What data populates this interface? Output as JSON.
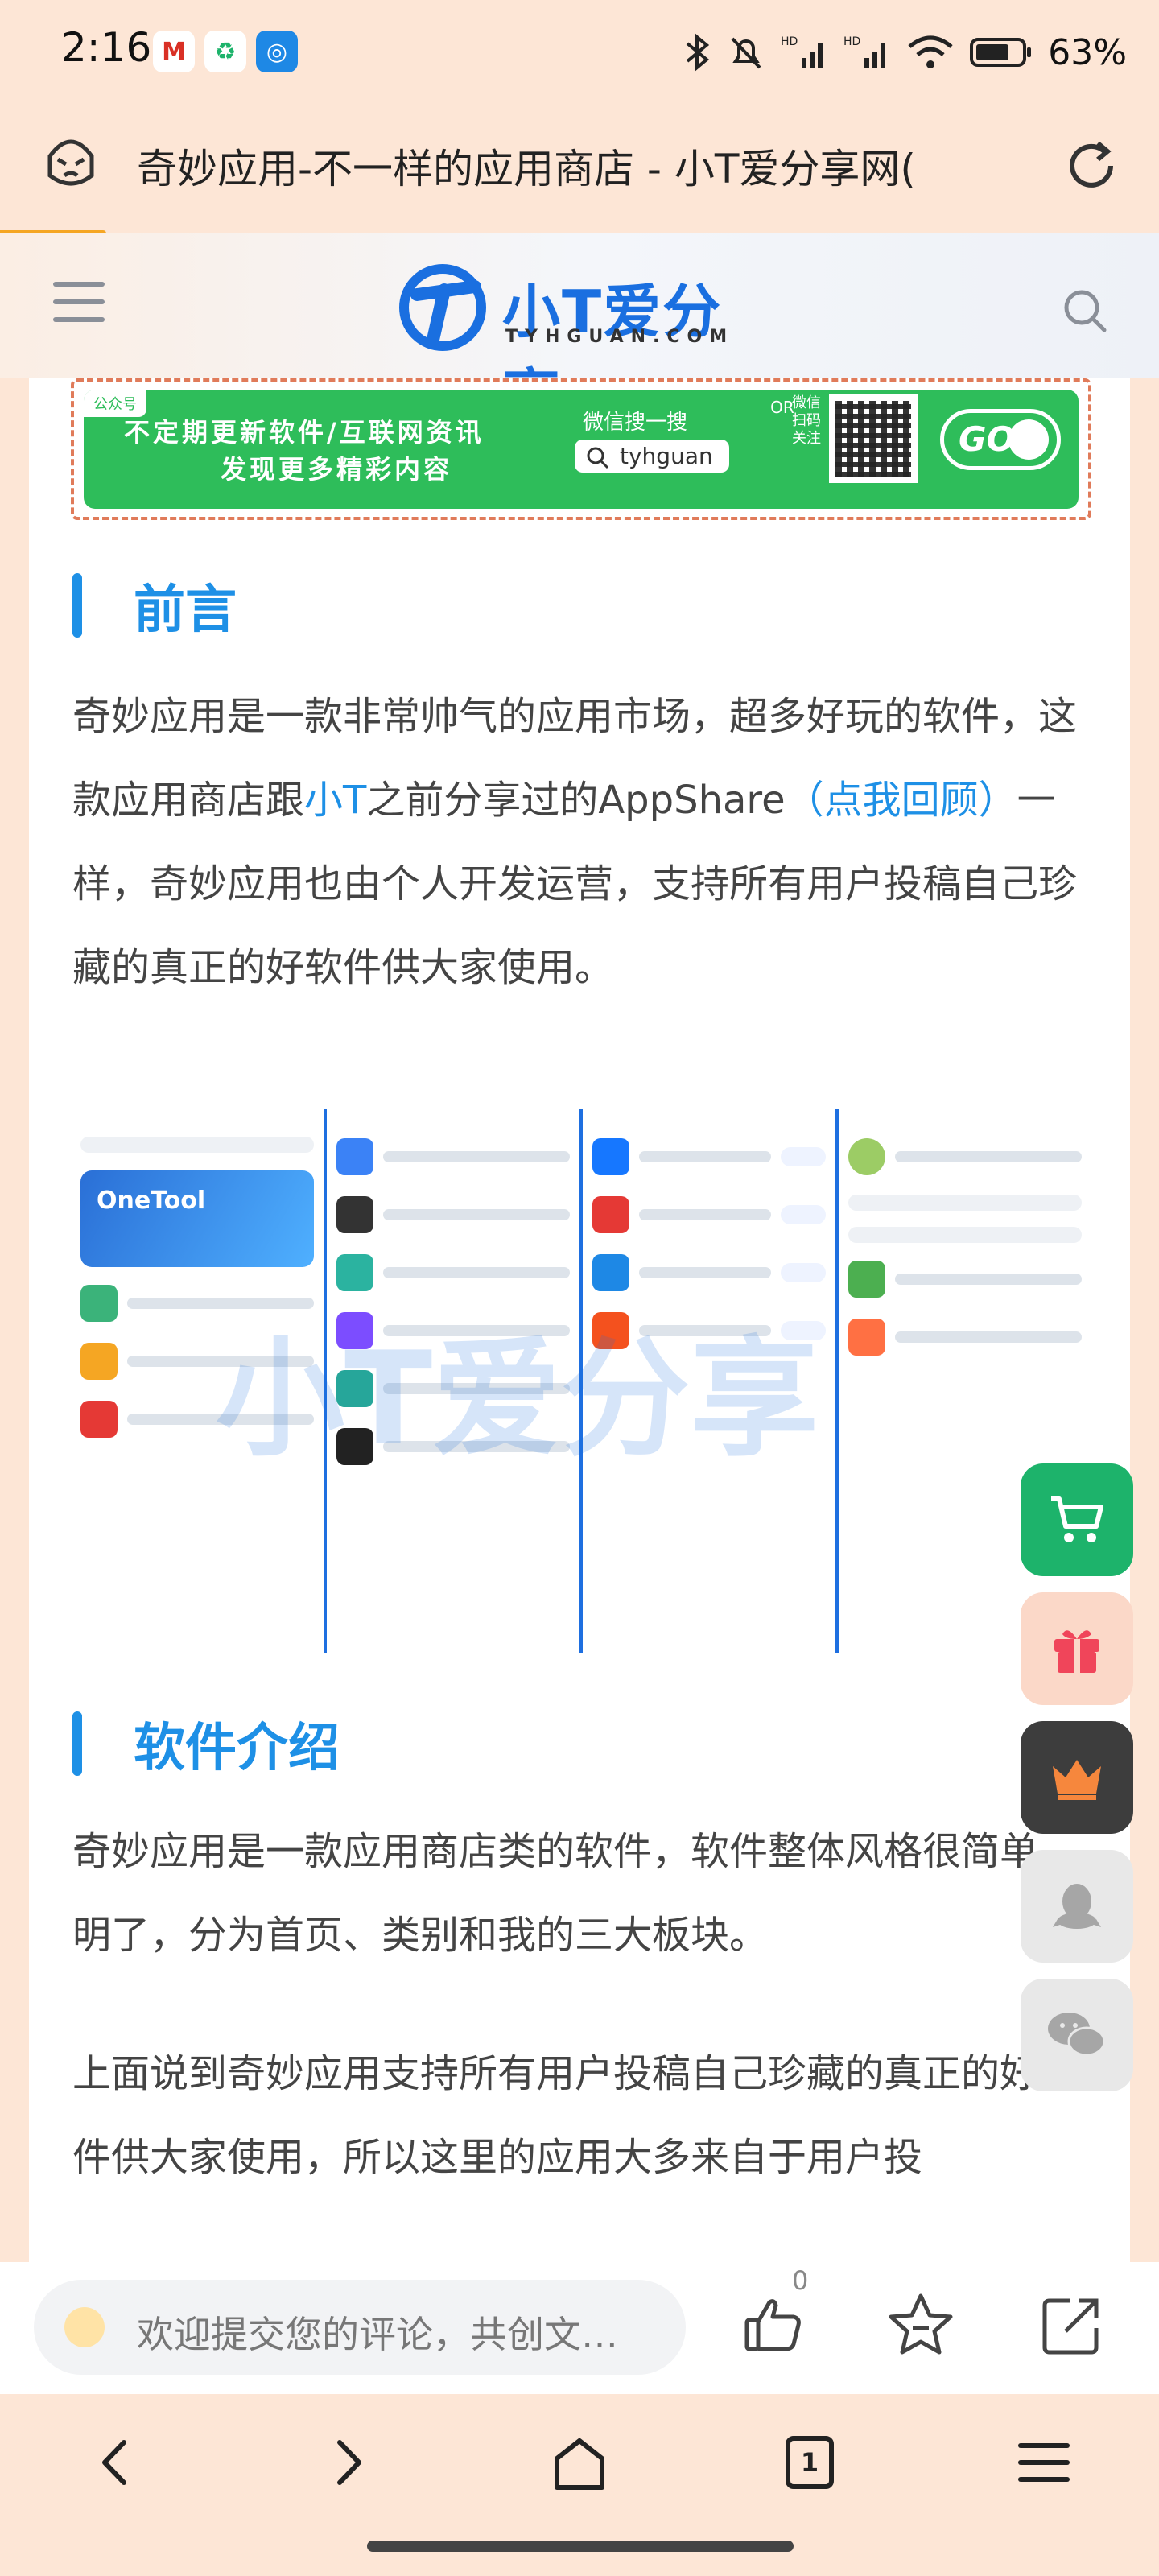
{
  "status_bar": {
    "time": "2:16",
    "battery": "63%"
  },
  "browser": {
    "page_title": "奇妙应用-不一样的应用商店 - 小T爱分享网("
  },
  "site": {
    "logo_text": "小T爱分享",
    "logo_sub": "TYHGUAN.COM"
  },
  "banner": {
    "tag": "公众号",
    "line1": "不定期更新软件/互联网资讯",
    "line2": "发现更多精彩内容",
    "wechat": "微信搜一搜",
    "account": "tyhguan",
    "or": "OR",
    "scan": "微信扫码关注",
    "go": "GO"
  },
  "article": {
    "section1_title": "前言",
    "p1_part1": "奇妙应用是一款非常帅气的应用市场，超多好玩的软件，这款应用商店跟",
    "p1_link1": "小T",
    "p1_part2": "之前分享过的AppShare",
    "p1_link2": "（点我回顾）",
    "p1_part3": "一样，奇妙应用也由个人开发运营，支持所有用户投稿自己珍藏的真正的好软件供大家使用。",
    "section2_title": "软件介绍",
    "p2": "奇妙应用是一款应用商店类的软件，软件整体风格很简单明了，分为首页、类别和我的三大板块。",
    "p3": "上面说到奇妙应用支持所有用户投稿自己珍藏的真正的好软件供大家使用，所以这里的应用大多来自于用户投"
  },
  "screenshots": {
    "shot1_card": "OneTool",
    "watermark": "小T爱分享"
  },
  "comment_bar": {
    "placeholder": "欢迎提交您的评论，共创文…",
    "like_count": "0"
  },
  "bottom_nav": {
    "tab_count": "1"
  }
}
